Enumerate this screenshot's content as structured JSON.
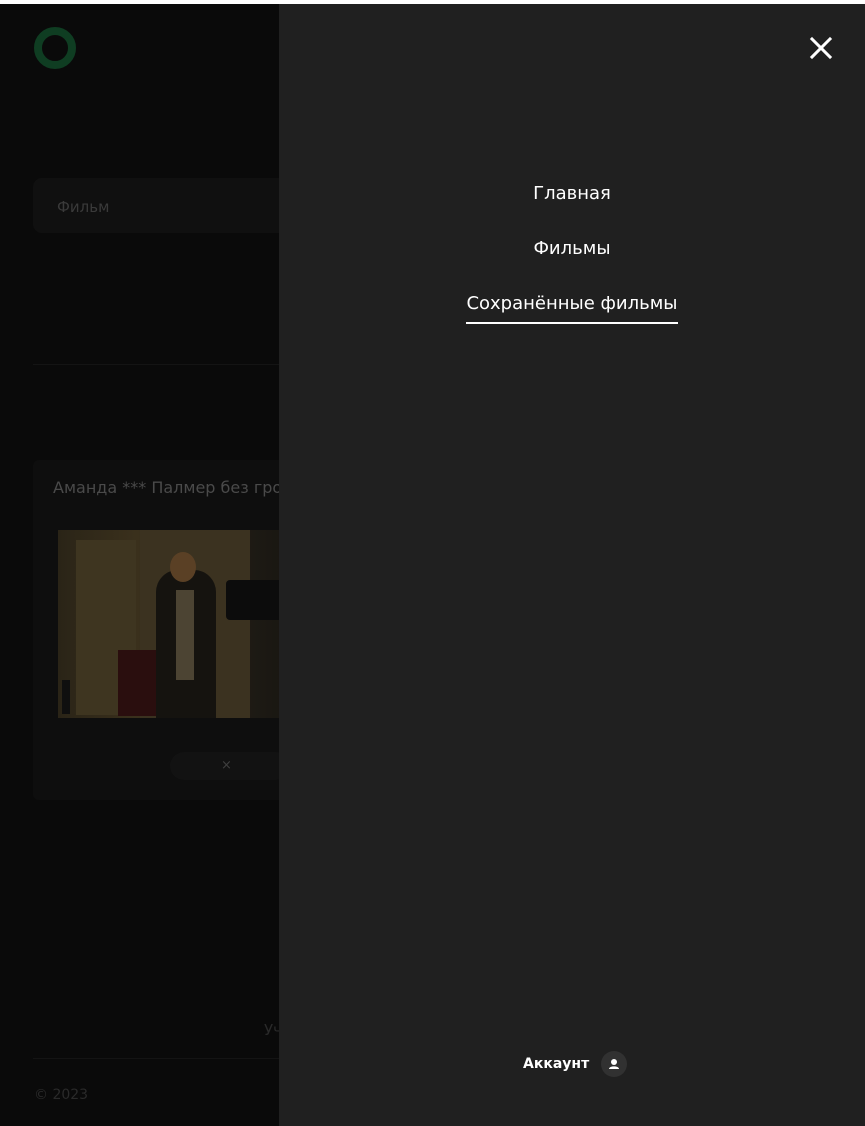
{
  "background_page": {
    "search": {
      "placeholder": "Фильм"
    },
    "movie_card": {
      "title": "Аманда *** Палмер без гро",
      "remove_label": "×"
    },
    "footer": {
      "partial_text": "Уч",
      "copyright": "© 2023"
    }
  },
  "menu": {
    "close_icon": "close-icon",
    "items": [
      {
        "label": "Главная",
        "active": false
      },
      {
        "label": "Фильмы",
        "active": false
      },
      {
        "label": "Сохранённые фильмы",
        "active": true
      }
    ],
    "account_label": "Аккаунт",
    "account_icon": "user-icon"
  },
  "colors": {
    "menu_background": "#202020",
    "overlay_background": "#0a0a0a",
    "text": "#ffffff",
    "logo_accent": "#0f3d22"
  }
}
